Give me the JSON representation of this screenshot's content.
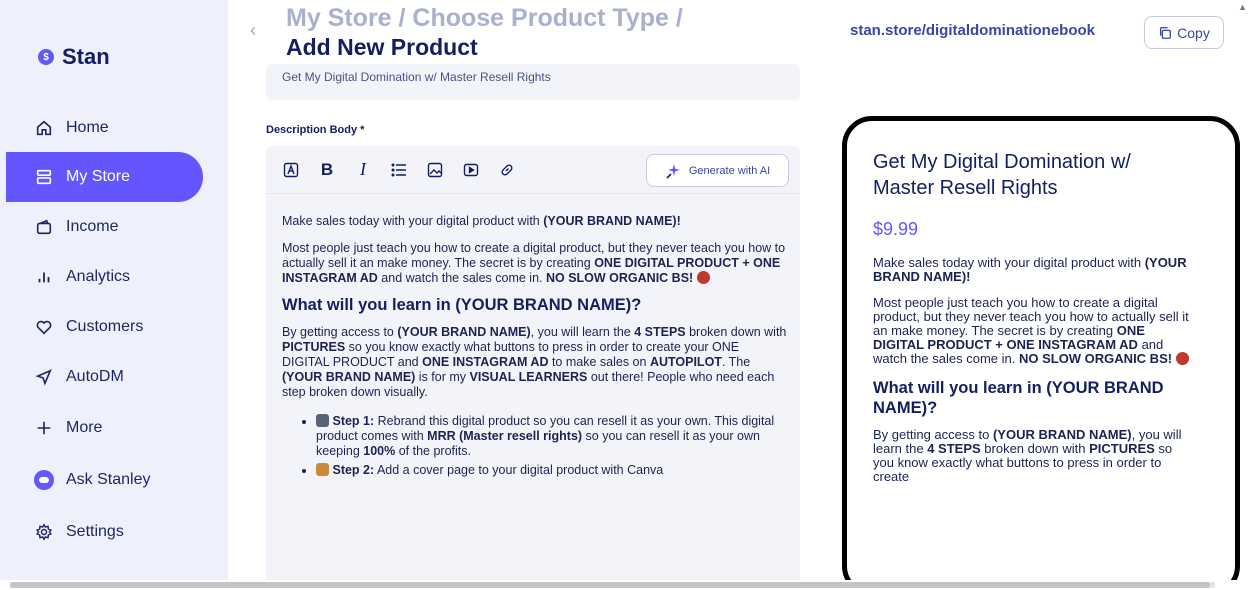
{
  "sidebar": {
    "brand": "Stan",
    "items": [
      {
        "label": "Home",
        "icon": "home-icon"
      },
      {
        "label": "My Store",
        "icon": "store-icon"
      },
      {
        "label": "Income",
        "icon": "wallet-icon"
      },
      {
        "label": "Analytics",
        "icon": "analytics-icon"
      },
      {
        "label": "Customers",
        "icon": "heart-icon"
      },
      {
        "label": "AutoDM",
        "icon": "send-icon"
      },
      {
        "label": "More",
        "icon": "plus-icon"
      },
      {
        "label": "Ask Stanley",
        "icon": "stanley-icon"
      },
      {
        "label": "Settings",
        "icon": "gear-icon"
      }
    ],
    "active": "My Store"
  },
  "header": {
    "breadcrumb": "My Store / Choose Product Type /",
    "title": "Add New Product",
    "store_url": "stan.store/digitaldominationebook",
    "copy_label": "Copy"
  },
  "form": {
    "title_value": "Get My Digital Domination w/ Master Resell Rights",
    "description_label": "Description Body *",
    "generate_ai_label": "Generate with AI"
  },
  "editor": {
    "p1_text": "Make sales today with your digital product with ",
    "brand": "(YOUR BRAND NAME)!",
    "p2_a": "Most people just teach you how to create a digital product, but they never teach you how to actually sell it an make money. The secret is by creating ",
    "p2_b": "ONE DIGITAL PRODUCT + ONE INSTAGRAM AD",
    "p2_c": " and watch the sales come in. ",
    "p2_d": "NO SLOW ORGANIC BS!",
    "heading": "What will you learn in (YOUR BRAND NAME)?",
    "p3_a": "By getting access to ",
    "p3_b": "(YOUR BRAND NAME)",
    "p3_c": ", you will learn the ",
    "p3_d": "4 STEPS",
    "p3_e": " broken down with ",
    "p3_f": "PICTURES",
    "p3_g": " so you know exactly what buttons to press in order to create your ONE DIGITAL PRODUCT and ",
    "p3_h": "ONE INSTAGRAM AD",
    "p3_i": " to make sales on ",
    "p3_j": "AUTOPILOT",
    "p3_k": ". The ",
    "p3_l": "(YOUR BRAND NAME)",
    "p3_m": " is for my ",
    "p3_n": "VISUAL LEARNERS",
    "p3_o": " out there! People who need each step broken down visually.",
    "step1_label": "Step 1:",
    "step1_a": " Rebrand this digital product so you can resell it as your own. This digital product comes with ",
    "step1_b": "MRR (Master resell rights)",
    "step1_c": " so you can resell it as your own keeping ",
    "step1_d": "100%",
    "step1_e": " of the profits.",
    "step2_label": "Step 2:",
    "step2_a": " Add a cover page to your digital product with Canva"
  },
  "preview": {
    "title": "Get My Digital Domination w/ Master Resell Rights",
    "price": "$9.99",
    "p1_a": "Make sales today with your digital product with ",
    "p1_b": "(YOUR BRAND NAME)!",
    "p2_a": "Most people just teach you how to create a digital product, but they never teach you how to actually sell it an make money. The secret is by creating ",
    "p2_b": "ONE DIGITAL PRODUCT + ONE INSTAGRAM AD",
    "p2_c": " and watch the sales come in. ",
    "p2_d": "NO SLOW ORGANIC BS!",
    "heading": "What will you learn in (YOUR BRAND NAME)?",
    "p3_a": "By getting access to ",
    "p3_b": "(YOUR BRAND NAME)",
    "p3_c": ", you will learn the ",
    "p3_d": "4 STEPS",
    "p3_e": " broken down with ",
    "p3_f": "PICTURES",
    "p3_g": " so you know exactly what buttons to press in order to create"
  },
  "colors": {
    "accent": "#6356ff",
    "navy": "#131f60",
    "sidebar_bg": "#eef0fb"
  }
}
